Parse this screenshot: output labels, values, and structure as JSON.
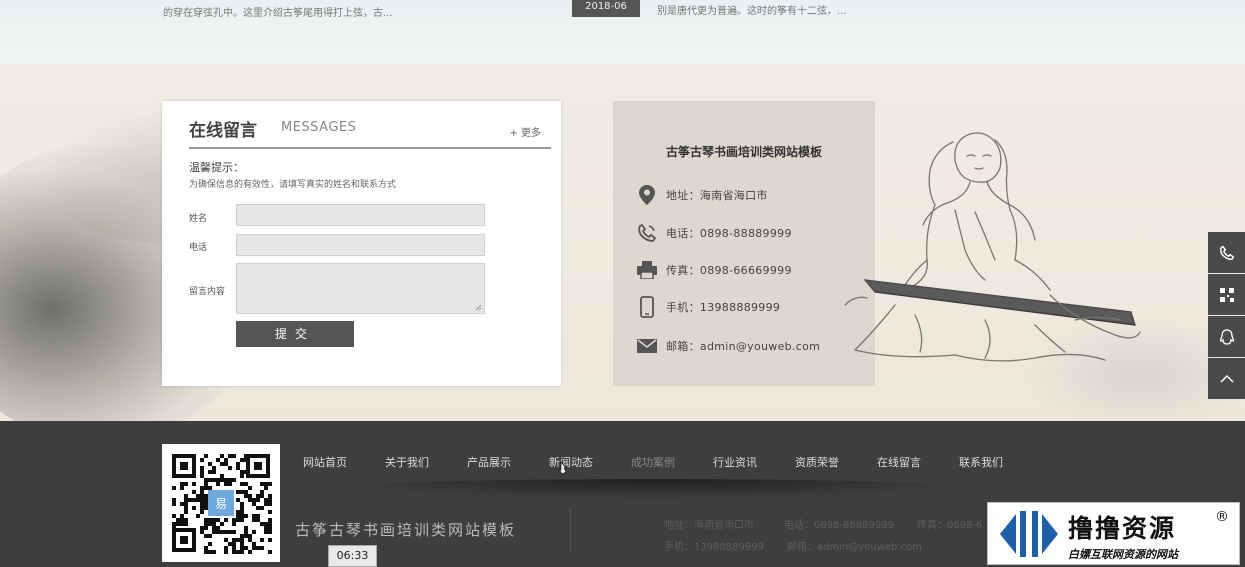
{
  "top": {
    "left_text": "的穿在穿弦孔中。这里介绍古筝尾用得打上弦，古...",
    "date": "2018-06",
    "right_text": "别是唐代更为普遍。这时的筝有十二弦，..."
  },
  "message": {
    "title": "在线留言",
    "subtitle": "MESSAGES",
    "more": "+ 更多",
    "tip_title": "温馨提示：",
    "tip_text": "为确保信息的有效性，请填写真实的姓名和联系方式",
    "name_label": "姓名",
    "phone_label": "电话",
    "content_label": "留言内容",
    "submit": "提交"
  },
  "contact": {
    "title": "古筝古琴书画培训类网站模板",
    "address": "地址：海南省海口市",
    "phone": "电话：0898-88889999",
    "fax": "传真：0898-66669999",
    "mobile": "手机：13988889999",
    "email": "邮箱：admin@youweb.com",
    "icons": [
      "location-icon",
      "phone-icon",
      "fax-icon",
      "mobile-icon",
      "mail-icon"
    ]
  },
  "sidebar": {
    "icons": [
      "phone-icon",
      "qrcode-icon",
      "qq-icon",
      "back-to-top-icon"
    ]
  },
  "footer": {
    "nav": [
      "网站首页",
      "关于我们",
      "产品展示",
      "新闻动态",
      "成功案例",
      "行业资讯",
      "资质荣誉",
      "在线留言",
      "联系我们"
    ],
    "site_name": "古筝古琴书画培训类网站模板",
    "address": "地址：海南省海口市",
    "phone": "电话：0898-88889999",
    "fax": "传真：0898-6",
    "mobile": "手机：13988889999",
    "email": "邮箱：admin@youweb.com",
    "qr_center": "易"
  },
  "overlay": {
    "time": "06:33",
    "watermark_title": "撸撸资源",
    "watermark_reg": "®",
    "watermark_sub": "白嫖互联网资源的网站"
  },
  "colors": {
    "footer_bg": "#3d3e3e",
    "contact_bg": "#dcd8cd",
    "button_bg": "#555555",
    "page_bg": "#efeadf"
  }
}
